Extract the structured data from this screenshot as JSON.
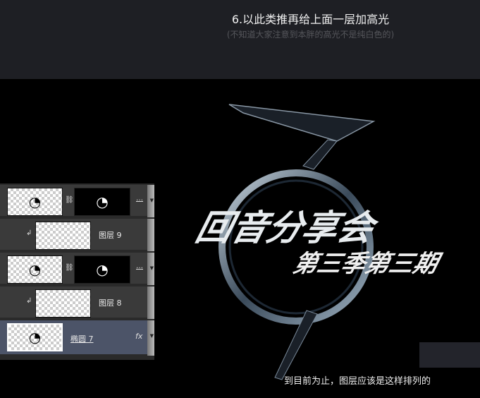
{
  "header": {
    "title": "6.以此类推再给上面一层加高光",
    "subtitle": "(不知道大家注意到本胖的高光不是纯白色的)"
  },
  "artwork": {
    "title": "回音分享会",
    "subtitle": "第三季第三期"
  },
  "layers": [
    {
      "name": "",
      "type": "shape-with-mask"
    },
    {
      "name": "图层 9",
      "type": "clipped"
    },
    {
      "name": "",
      "type": "shape-with-mask"
    },
    {
      "name": "图层 8",
      "type": "clipped"
    },
    {
      "name": "椭圆 7",
      "type": "shape",
      "selected": true,
      "fx": "fx"
    }
  ],
  "caption": "到目前为止，图层应该是这样排列的"
}
